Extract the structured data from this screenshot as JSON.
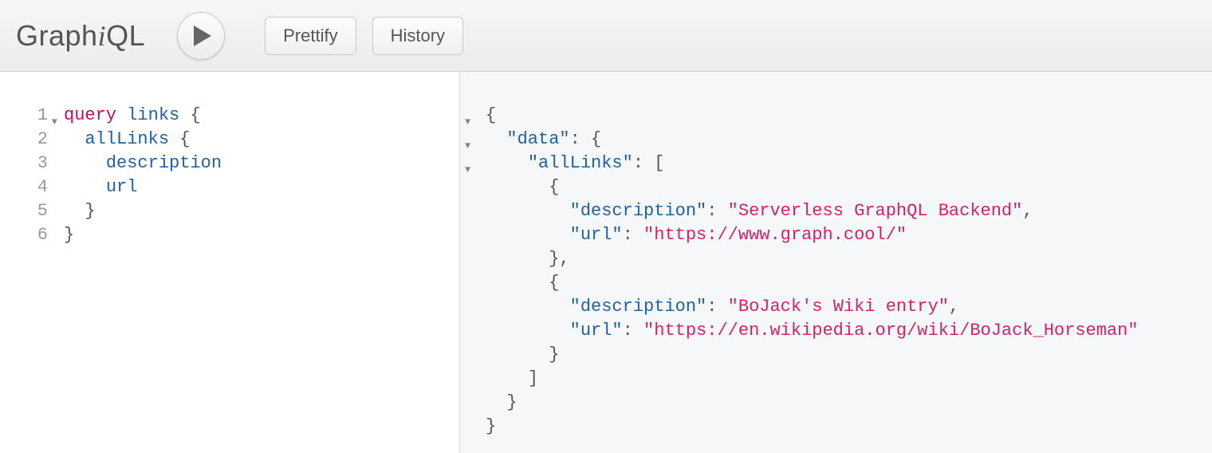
{
  "logo": {
    "pre": "Graph",
    "i": "i",
    "post": "QL"
  },
  "toolbar": {
    "prettify_label": "Prettify",
    "history_label": "History"
  },
  "query": {
    "line_numbers": [
      "1",
      "2",
      "3",
      "4",
      "5",
      "6"
    ],
    "keyword": "query",
    "op_name": "links",
    "root_field": "allLinks",
    "fields": [
      "description",
      "url"
    ]
  },
  "result": {
    "root_key": "\"data\"",
    "list_key": "\"allLinks\"",
    "items": [
      {
        "description_key": "\"description\"",
        "description_val": "\"Serverless GraphQL Backend\"",
        "url_key": "\"url\"",
        "url_val": "\"https://www.graph.cool/\""
      },
      {
        "description_key": "\"description\"",
        "description_val": "\"BoJack's Wiki entry\"",
        "url_key": "\"url\"",
        "url_val": "\"https://en.wikipedia.org/wiki/BoJack_Horseman\""
      }
    ]
  }
}
